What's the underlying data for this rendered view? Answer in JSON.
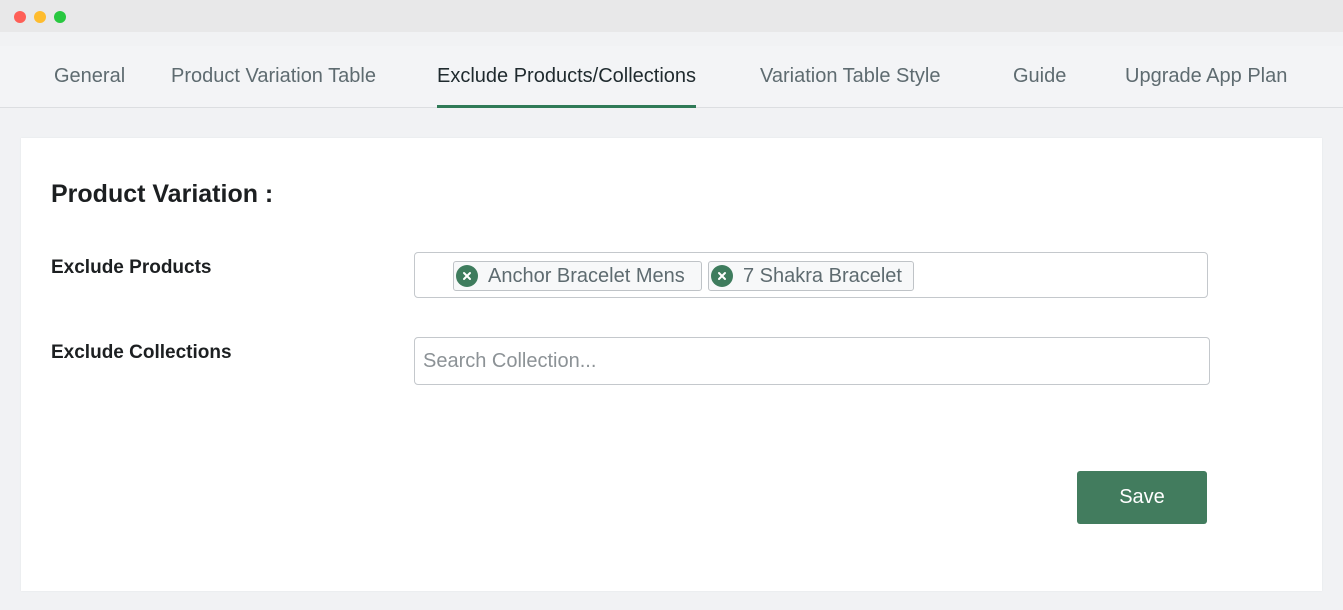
{
  "window": {
    "controls": {
      "close_color": "#fe5f57",
      "minimize_color": "#febc2e",
      "maximize_color": "#28c840"
    }
  },
  "tabs": [
    {
      "label": "General",
      "active": false
    },
    {
      "label": "Product Variation Table",
      "active": false
    },
    {
      "label": "Exclude Products/Collections",
      "active": true
    },
    {
      "label": "Variation Table Style",
      "active": false
    },
    {
      "label": "Guide",
      "active": false
    },
    {
      "label": "Upgrade App Plan",
      "active": false
    }
  ],
  "accent_color": "#2f7a57",
  "form": {
    "section_title": "Product Variation :",
    "exclude_products": {
      "label": "Exclude Products",
      "tags": [
        {
          "label": "Anchor Bracelet Mens",
          "remove_icon": "close-circle-icon"
        },
        {
          "label": "7 Shakra Bracelet",
          "remove_icon": "close-circle-icon"
        }
      ]
    },
    "exclude_collections": {
      "label": "Exclude Collections",
      "value": "",
      "placeholder": "Search Collection..."
    },
    "save_label": "Save",
    "save_color": "#427c5e"
  }
}
